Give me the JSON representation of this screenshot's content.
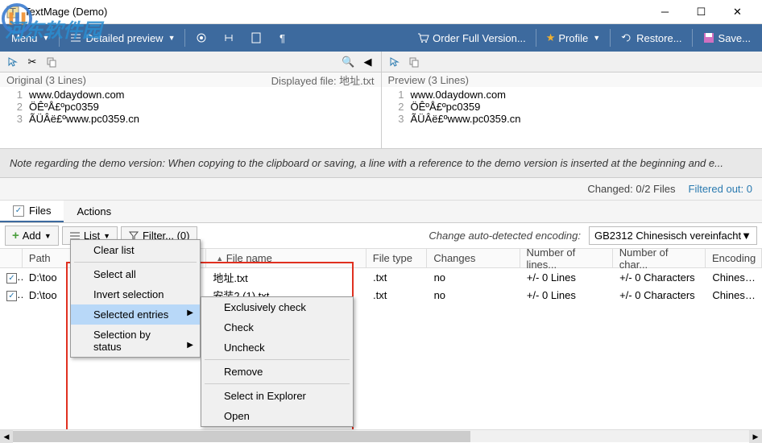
{
  "window": {
    "title": "TextMage (Demo)"
  },
  "toolbar": {
    "menu": "Menu",
    "detailed_preview": "Detailed preview",
    "order": "Order Full Version...",
    "profile": "Profile",
    "restore": "Restore...",
    "save": "Save..."
  },
  "panes": {
    "left": {
      "header": "Original (3 Lines)",
      "displayed": "Displayed file: 地址.txt",
      "lines": [
        "www.0daydown.com",
        "ÖÊºÅ£ºpc0359",
        "ÃÜÂë£ºwww.pc0359.cn"
      ]
    },
    "right": {
      "header": "Preview (3 Lines)",
      "lines": [
        "www.0daydown.com",
        "ÖÊºÅ£ºpc0359",
        "ÃÜÂë£ºwww.pc0359.cn"
      ]
    }
  },
  "note": "Note regarding the demo version: When copying to the clipboard or saving, a line with a reference to the demo version is inserted at the beginning and e...",
  "status": {
    "changed": "Changed: 0/2 Files",
    "filtered": "Filtered out: 0"
  },
  "tabs": {
    "files": "Files",
    "actions": "Actions"
  },
  "files_toolbar": {
    "add": "Add",
    "list": "List",
    "filter": "Filter...  (0)",
    "encoding_label": "Change auto-detected encoding:",
    "encoding_value": "GB2312 Chinesisch vereinfacht"
  },
  "table": {
    "headers": {
      "path": "Path",
      "filename": "File name",
      "filetype": "File type",
      "changes": "Changes",
      "lines": "Number of lines...",
      "chars": "Number of char...",
      "encoding": "Encoding"
    },
    "rows": [
      {
        "path": "D:\\too",
        "filename": "地址.txt",
        "filetype": ".txt",
        "changes": "no",
        "lines": "+/- 0 Lines",
        "chars": "+/- 0 Characters",
        "encoding": "Chinese S"
      },
      {
        "path": "D:\\too",
        "filename": "安装2 (1).txt",
        "filetype": ".txt",
        "changes": "no",
        "lines": "+/- 0 Lines",
        "chars": "+/- 0 Characters",
        "encoding": "Chinese S"
      }
    ]
  },
  "menu1": {
    "clear": "Clear list",
    "select_all": "Select all",
    "invert": "Invert selection",
    "selected": "Selected entries",
    "by_status": "Selection by status"
  },
  "menu2": {
    "excl_check": "Exclusively check",
    "check": "Check",
    "uncheck": "Uncheck",
    "remove": "Remove",
    "explorer": "Select in Explorer",
    "open": "Open"
  },
  "watermark": "河东软件园"
}
